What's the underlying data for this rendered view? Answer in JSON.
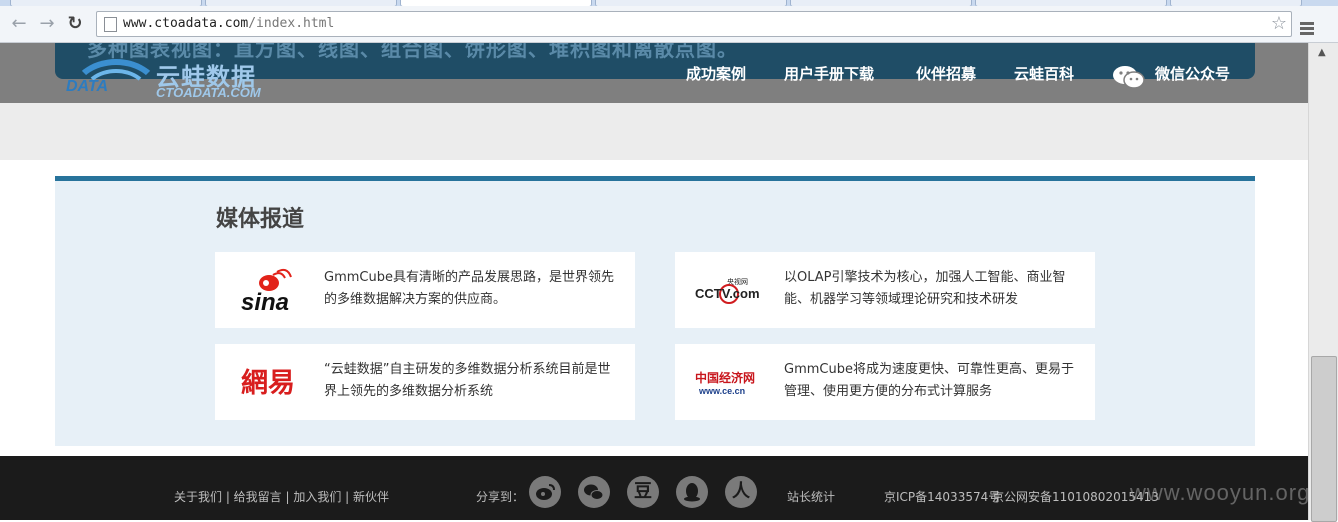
{
  "browser": {
    "url_host": "www.ctoadata.com",
    "url_path": "/index.html",
    "back_icon": "arrow-left-icon",
    "forward_icon": "arrow-right-icon",
    "reload_icon": "reload-icon",
    "bookmark_icon": "star-icon",
    "menu_icon": "menu-icon"
  },
  "header": {
    "banner_text": "多种图表视图：直方图、线图、组合图、饼形图、堆积图和离散点图。",
    "logo": {
      "data": "DATA",
      "brand_cn": "云蛙数据",
      "brand_en": "CTOADATA.COM"
    },
    "nav": [
      "成功案例",
      "用户手册下载",
      "伙伴招募",
      "云蛙百科",
      "微信公众号"
    ]
  },
  "media": {
    "title": "媒体报道",
    "cards": [
      {
        "source": "sina",
        "text": "GmmCube具有清晰的产品发展思路，是世界领先的多维数据解决方案的供应商。"
      },
      {
        "source": "CCTV.com",
        "source_cn": "央视网",
        "text": "以OLAP引擎技术为核心，加强人工智能、商业智能、机器学习等领域理论研究和技术研发"
      },
      {
        "source": "網易",
        "text": "“云蛙数据”自主研发的多维数据分析系统目前是世界上领先的多维数据分析系统"
      },
      {
        "source": "中国经济网",
        "source_url": "www.ce.cn",
        "text": "GmmCube将成为速度更快、可靠性更高、更易于管理、使用更方便的分布式计算服务"
      }
    ]
  },
  "footer": {
    "links": "关于我们 | 给我留言 | 加入我们 | 新伙伴",
    "share_label": "分享到：",
    "share_icons": [
      "weibo-icon",
      "wechat-icon",
      "douban-icon",
      "qq-icon",
      "renren-icon"
    ],
    "douban_glyph": "豆",
    "renren_glyph": "人",
    "stats": "站长统计",
    "icp": "京ICP备14033574号",
    "police": "京公网安备11010802015413"
  },
  "watermark": "www.wooyun.org",
  "colors": {
    "accent": "#27739b",
    "header_gray": "#7f7f7f",
    "footer": "#1b1b1b",
    "media_bg": "#e7f0f7"
  }
}
